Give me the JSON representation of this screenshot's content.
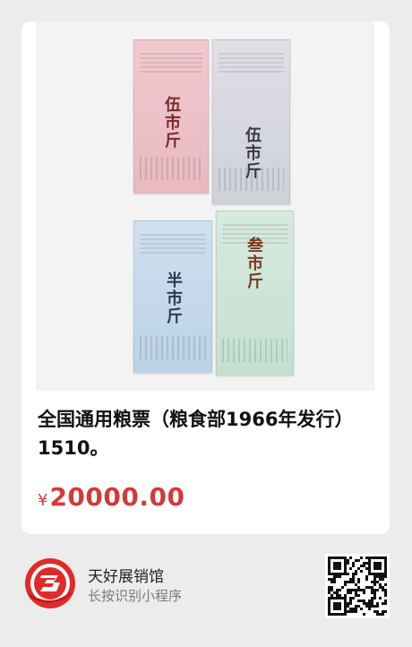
{
  "product": {
    "title": "全国通用粮票（粮食部1966年发行）1510。",
    "currency_symbol": "¥",
    "price": "20000.00",
    "price_color": "#d23a3a"
  },
  "photo": {
    "tickets": [
      {
        "denomination": "伍市斤"
      },
      {
        "denomination": "伍市斤"
      },
      {
        "denomination": "半市斤"
      },
      {
        "denomination": "叁市斤"
      }
    ]
  },
  "shop": {
    "name": "天好展销馆",
    "subtitle": "长按识别小程序",
    "logo_icon": "shop-logo-icon",
    "qr_icon": "mini-program-qr-code"
  }
}
